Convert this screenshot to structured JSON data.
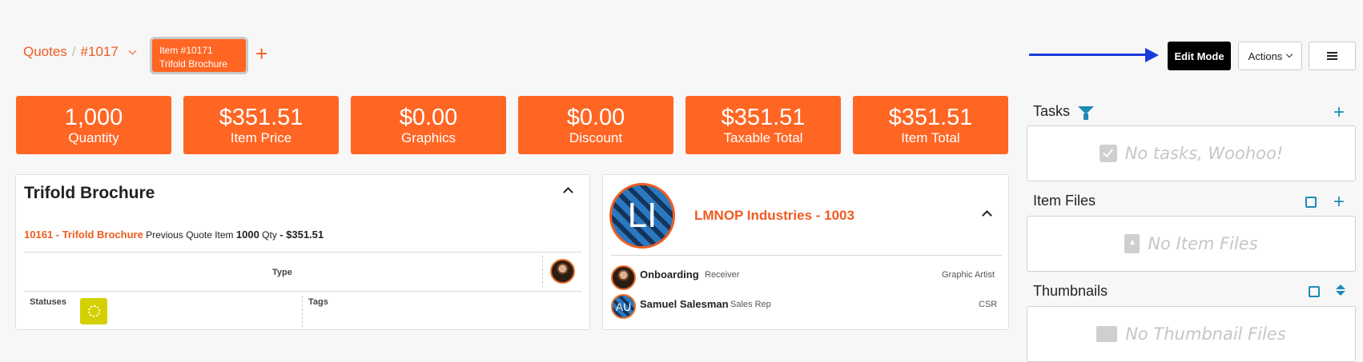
{
  "breadcrumb": {
    "root": "Quotes",
    "separator": "/",
    "current": "#1017"
  },
  "item_tab": {
    "line1": "Item #10171",
    "line2": "Trifold Brochure"
  },
  "toolbar": {
    "edit_mode": "Edit Mode",
    "actions": "Actions"
  },
  "stats": [
    {
      "value": "1,000",
      "label": "Quantity"
    },
    {
      "value": "$351.51",
      "label": "Item Price"
    },
    {
      "value": "$0.00",
      "label": "Graphics"
    },
    {
      "value": "$0.00",
      "label": "Discount"
    },
    {
      "value": "$351.51",
      "label": "Taxable Total"
    },
    {
      "value": "$351.51",
      "label": "Item Total"
    }
  ],
  "item_card": {
    "title": "Trifold Brochure",
    "item_link": "10161 - Trifold Brochure",
    "prev_label": "Previous Quote Item",
    "qty": "1000",
    "qty_label": "Qty",
    "price": "- $351.51",
    "type_label": "Type",
    "statuses_label": "Statuses",
    "tags_label": "Tags"
  },
  "company_card": {
    "initials": "LI",
    "name": "LMNOP Industries - 1003",
    "contacts": [
      {
        "name": "Onboarding",
        "role": "Receiver",
        "right": "Graphic Artist"
      },
      {
        "name": "Samuel Salesman",
        "role": "Sales Rep",
        "right": "CSR",
        "initials": "AU"
      }
    ]
  },
  "panel": {
    "tasks_title": "Tasks",
    "tasks_empty": "No tasks, Woohoo!",
    "files_title": "Item Files",
    "files_empty": "No Item Files",
    "thumbs_title": "Thumbnails",
    "thumbs_empty": "No Thumbnail Files"
  },
  "colors": {
    "accent": "#ff6624",
    "brand_text": "#ef5b21",
    "blue": "#1d8ab6",
    "arrow": "#1a3bdc"
  }
}
